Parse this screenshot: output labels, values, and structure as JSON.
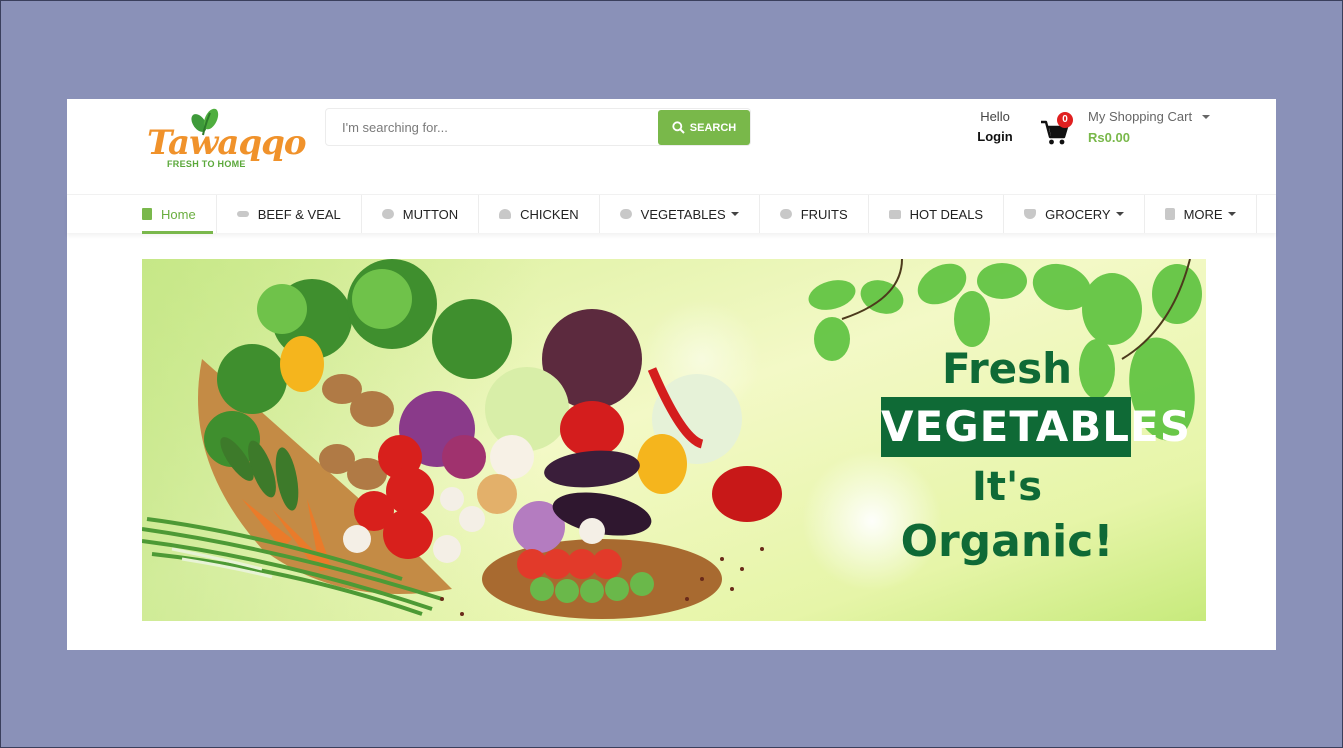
{
  "header": {
    "logo": {
      "wordmark": "Tawaqqo",
      "tagline": "FRESH TO HOME"
    },
    "search": {
      "placeholder": "I'm searching for...",
      "button_label": "SEARCH"
    },
    "account": {
      "greeting": "Hello",
      "login_label": "Login"
    },
    "cart": {
      "title": "My Shopping Cart",
      "count": "0",
      "total": "Rs0.00"
    }
  },
  "nav": {
    "items": [
      {
        "label": "Home",
        "icon": "document-icon",
        "active": true
      },
      {
        "label": "BEEF & VEAL",
        "icon": "steak-icon"
      },
      {
        "label": "MUTTON",
        "icon": "meat-icon"
      },
      {
        "label": "CHICKEN",
        "icon": "chicken-icon"
      },
      {
        "label": "VEGETABLES",
        "icon": "vegetable-icon",
        "dropdown": true
      },
      {
        "label": "FRUITS",
        "icon": "fruit-icon"
      },
      {
        "label": "HOT DEALS",
        "icon": "deals-icon"
      },
      {
        "label": "GROCERY",
        "icon": "grocery-icon",
        "dropdown": true
      },
      {
        "label": "MORE",
        "icon": "list-icon",
        "dropdown": true
      }
    ]
  },
  "banner": {
    "line1": "Fresh",
    "line2": "VEGETABLES",
    "line3": "It's",
    "line4": "Organic!"
  },
  "colors": {
    "brand_green": "#79b84a",
    "brand_orange": "#f0922b",
    "banner_text": "#0f6a36",
    "badge_red": "#e02020",
    "page_background": "#8a91b8"
  }
}
